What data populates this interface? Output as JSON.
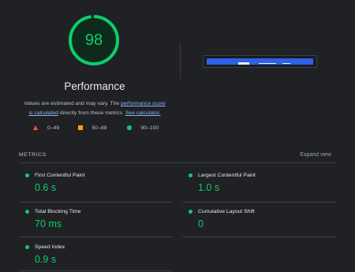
{
  "gauge": {
    "score": "98",
    "fraction": 0.98,
    "color": "#0cce6b"
  },
  "performance": {
    "title": "Performance",
    "desc_prefix": "Values are estimated and may vary. The ",
    "link_score": "performance score",
    "link_score_2": "is calculated",
    "desc_middle": " directly from these metrics. ",
    "link_calc": "See calculator."
  },
  "legend": [
    {
      "label": "0–49",
      "color": "#ff4e42",
      "icon": "triangle-icon"
    },
    {
      "label": "50–89",
      "color": "#ffa400",
      "icon": "square-icon"
    },
    {
      "label": "90–100",
      "color": "#0cce6b",
      "icon": "circle-icon"
    }
  ],
  "metrics_header": "METRICS",
  "expand_label": "Expand view",
  "metrics": [
    {
      "label": "First Contentful Paint",
      "value": "0.6 s",
      "status": "#0cce6b"
    },
    {
      "label": "Largest Contentful Paint",
      "value": "1.0 s",
      "status": "#0cce6b"
    },
    {
      "label": "Total Blocking Time",
      "value": "70 ms",
      "status": "#0cce6b"
    },
    {
      "label": "Cumulative Layout Shift",
      "value": "0",
      "status": "#0cce6b"
    },
    {
      "label": "Speed Index",
      "value": "0.9 s",
      "status": "#0cce6b"
    }
  ],
  "colors": {
    "background": "#202124",
    "pass": "#0cce6b",
    "link": "#8ab4f8"
  }
}
